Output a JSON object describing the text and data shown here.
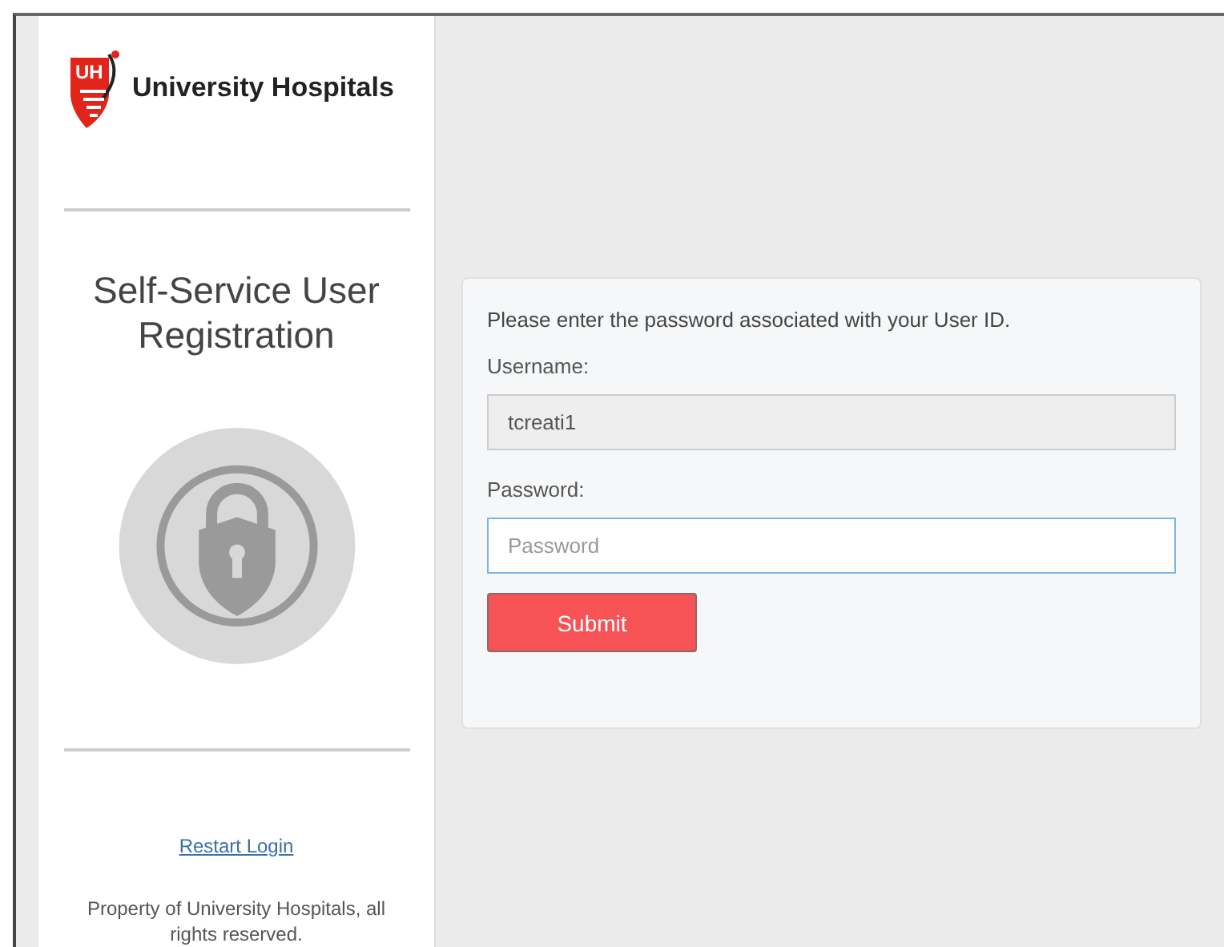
{
  "sidebar": {
    "logo": {
      "mark": "UH",
      "name": "University Hospitals"
    },
    "title": "Self-Service User Registration",
    "link": "Restart Login",
    "footer": "Property of University Hospitals, all rights reserved."
  },
  "form": {
    "instruction": "Please enter the password associated with your User ID.",
    "fields": [
      {
        "label": "Username:",
        "value": "tcreati1",
        "disabled": true
      },
      {
        "label": "Password:",
        "placeholder": "Password",
        "disabled": false
      }
    ],
    "button": "Submit"
  }
}
